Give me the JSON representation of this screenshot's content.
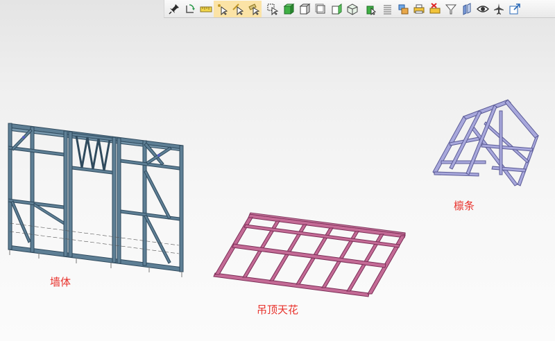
{
  "toolbar": {
    "buttons": [
      {
        "name": "pin-icon",
        "active": false
      },
      {
        "name": "rotate-icon",
        "active": false
      },
      {
        "name": "ruler-icon",
        "active": false
      },
      {
        "name": "select-point-icon",
        "active": true
      },
      {
        "name": "select-edge-icon",
        "active": true
      },
      {
        "name": "select-face-icon",
        "active": true
      },
      {
        "name": "select-box-icon",
        "active": false
      },
      {
        "name": "shaded-cube-icon",
        "active": false
      },
      {
        "name": "front-view-icon",
        "active": false
      },
      {
        "name": "back-view-icon",
        "active": false
      },
      {
        "name": "side-view-icon",
        "active": false
      },
      {
        "name": "iso-view-icon",
        "active": false
      },
      {
        "name": "select-solid-icon",
        "active": false
      },
      {
        "name": "list-icon",
        "active": false
      },
      {
        "name": "layers-icon",
        "active": false
      },
      {
        "name": "print-icon",
        "active": false
      },
      {
        "name": "delete-print-icon",
        "active": false
      },
      {
        "name": "filter-icon",
        "active": false
      },
      {
        "name": "section-icon",
        "active": false
      },
      {
        "name": "eye-icon",
        "active": false
      },
      {
        "name": "plane-icon",
        "active": false
      },
      {
        "name": "export-icon",
        "active": false
      }
    ]
  },
  "labels": {
    "wall": "墙体",
    "ceiling": "吊顶天花",
    "purlin": "檩条"
  },
  "colors": {
    "wall_frame": "#3d5a6e",
    "ceiling_frame": "#b0507e",
    "purlin_frame": "#8c8cc8",
    "label": "#e8302a"
  }
}
